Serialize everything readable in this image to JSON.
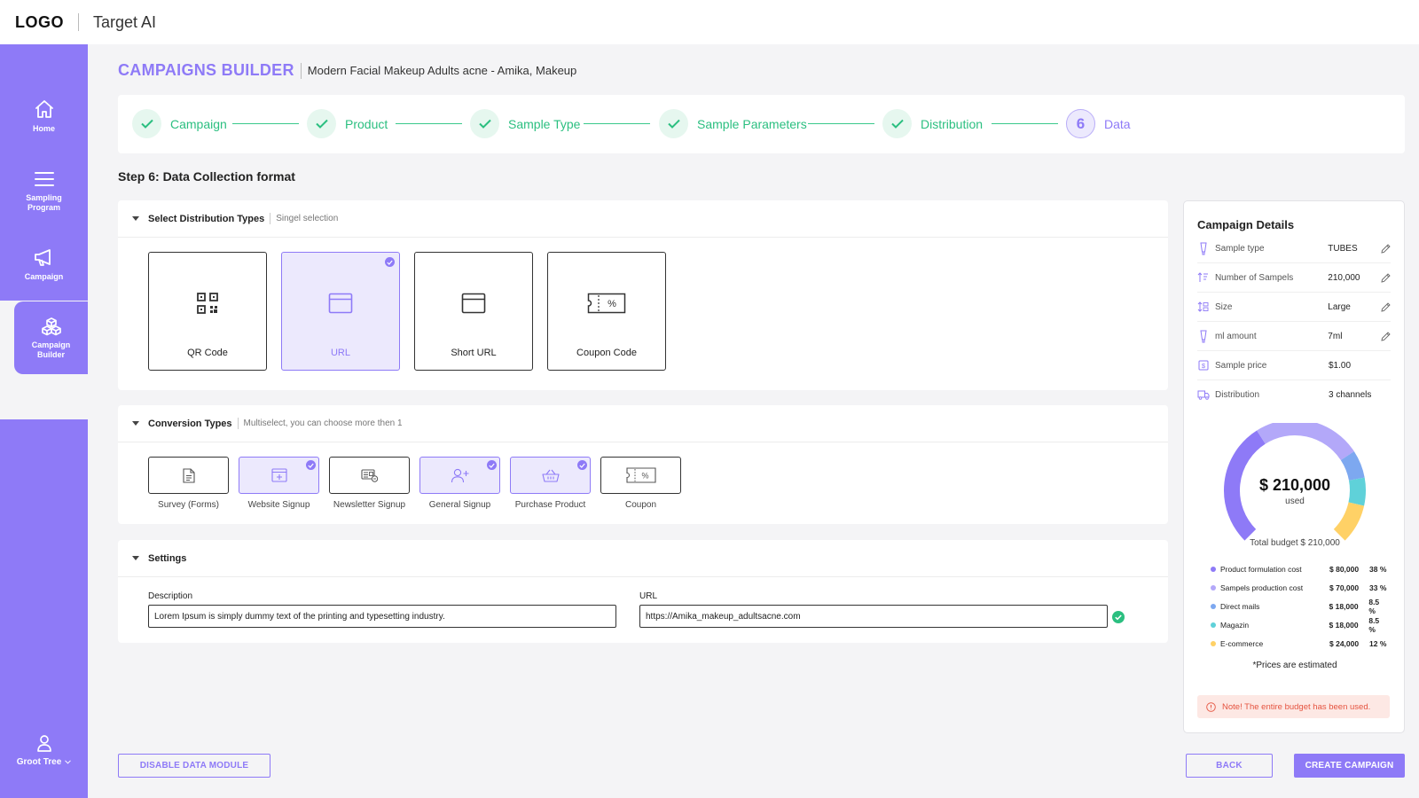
{
  "topbar": {
    "logo": "LOGO",
    "app_name": "Target AI"
  },
  "sidebar": {
    "items": [
      {
        "label": "Home",
        "icon": "home-icon"
      },
      {
        "label": "Sampling Program",
        "icon": "menu-icon"
      },
      {
        "label": "Campaign",
        "icon": "megaphone-icon"
      },
      {
        "label": "Campaign Builder",
        "icon": "boxes-icon",
        "active": true
      }
    ],
    "user": {
      "name": "Groot Tree",
      "icon": "user-icon"
    }
  },
  "header": {
    "title": "CAMPAIGNS BUILDER",
    "subtitle": "Modern Facial Makeup Adults acne - Amika, Makeup"
  },
  "stepper": {
    "steps": [
      {
        "label": "Campaign",
        "status": "done"
      },
      {
        "label": "Product",
        "status": "done"
      },
      {
        "label": "Sample Type",
        "status": "done"
      },
      {
        "label": "Sample Parameters",
        "status": "done"
      },
      {
        "label": "Distribution",
        "status": "done"
      },
      {
        "label": "Data",
        "number": "6",
        "status": "current"
      }
    ]
  },
  "step_heading": "Step 6: Data Collection format",
  "distribution": {
    "title": "Select Distribution Types",
    "subtitle": "Singel selection",
    "options": [
      {
        "label": "QR Code",
        "icon": "qr-code-icon",
        "selected": false
      },
      {
        "label": "URL",
        "icon": "browser-window-icon",
        "selected": true
      },
      {
        "label": "Short URL",
        "icon": "browser-window-icon",
        "selected": false
      },
      {
        "label": "Coupon Code",
        "icon": "coupon-icon",
        "selected": false
      }
    ]
  },
  "conversion": {
    "title": "Conversion Types",
    "subtitle": "Multiselect, you can choose more then 1",
    "options": [
      {
        "label": "Survey (Forms)",
        "icon": "document-icon",
        "selected": false
      },
      {
        "label": "Website Signup",
        "icon": "browser-add-icon",
        "selected": true
      },
      {
        "label": "Newsletter Signup",
        "icon": "newsletter-icon",
        "selected": false
      },
      {
        "label": "General Signup",
        "icon": "user-add-icon",
        "selected": true
      },
      {
        "label": "Purchase Product",
        "icon": "basket-icon",
        "selected": true
      },
      {
        "label": "Coupon",
        "icon": "coupon-icon",
        "selected": false
      }
    ]
  },
  "settings": {
    "title": "Settings",
    "description_label": "Description",
    "description_value": "Lorem Ipsum is simply dummy text of the printing and typesetting industry.",
    "url_label": "URL",
    "url_value": "https://Amika_makeup_adultsacne.com"
  },
  "details": {
    "title": "Campaign Details",
    "rows": [
      {
        "label": "Sample type",
        "value": "TUBES",
        "icon": "tube-icon",
        "editable": true
      },
      {
        "label": "Number of Sampels",
        "value": "210,000",
        "icon": "sort-icon",
        "editable": true
      },
      {
        "label": "Size",
        "value": "Large",
        "icon": "size-icon",
        "editable": true
      },
      {
        "label": "ml amount",
        "value": "7ml",
        "icon": "tube-icon",
        "editable": true
      },
      {
        "label": "Sample price",
        "value": "$1.00",
        "icon": "price-icon",
        "editable": false
      },
      {
        "label": "Distribution",
        "value": "3 channels",
        "icon": "truck-icon",
        "editable": false
      }
    ],
    "donut_amount": "$ 210,000",
    "donut_used_label": "used",
    "total_budget": "Total budget $ 210,000",
    "breakdown": [
      {
        "label": "Product formulation cost",
        "amount": "$ 80,000",
        "percent": "38 %",
        "value": 38,
        "color": "#8e7af7"
      },
      {
        "label": "Sampels production cost",
        "amount": "$ 70,000",
        "percent": "33 %",
        "value": 33,
        "color": "#b3a8f9"
      },
      {
        "label": "Direct mails",
        "amount": "$ 18,000",
        "percent": "8.5 %",
        "value": 8.5,
        "color": "#7da8f0"
      },
      {
        "label": "Magazin",
        "amount": "$ 18,000",
        "percent": "8.5 %",
        "value": 8.5,
        "color": "#5fd1d9"
      },
      {
        "label": "E-commerce",
        "amount": "$ 24,000",
        "percent": "12 %",
        "value": 12,
        "color": "#ffd166"
      }
    ],
    "estimate_note": "*Prices are estimated",
    "warning": "Note! The entire budget has been used."
  },
  "footer": {
    "disable_label": "DISABLE DATA MODULE",
    "back_label": "BACK",
    "create_label": "CREATE CAMPAIGN"
  },
  "colors": {
    "accent": "#8e7af7",
    "success": "#2bbf80",
    "warning": "#e5533f"
  }
}
